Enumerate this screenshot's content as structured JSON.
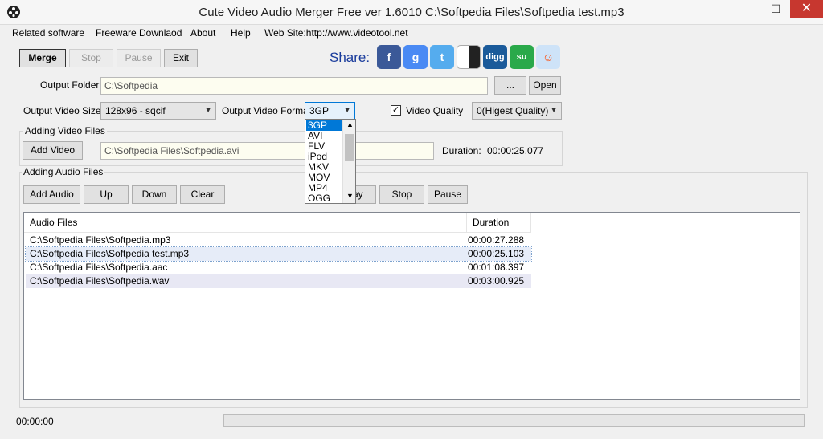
{
  "window": {
    "title": "Cute Video Audio Merger Free  ver 1.6010  C:\\Softpedia Files\\Softpedia test.mp3",
    "minimize": "—",
    "maximize": "☐",
    "close": "✕"
  },
  "menu": {
    "items": [
      "Related software",
      "Freeware Downlaod",
      "About",
      "Help",
      "Web Site:http://www.videotool.net"
    ]
  },
  "toolbar": {
    "merge": "Merge",
    "stop": "Stop",
    "pause": "Pause",
    "exit": "Exit",
    "share_label": "Share:"
  },
  "share_icons": [
    {
      "name": "facebook-icon",
      "glyph": "f",
      "color": "#3b5998"
    },
    {
      "name": "google-icon",
      "glyph": "g",
      "color": "#4a8af4"
    },
    {
      "name": "twitter-icon",
      "glyph": "t",
      "color": "#55acee"
    },
    {
      "name": "delicious-icon",
      "glyph": "",
      "color": "#3274d1"
    },
    {
      "name": "digg-icon",
      "glyph": "digg",
      "color": "#1a5a9a"
    },
    {
      "name": "stumbleupon-icon",
      "glyph": "su",
      "color": "#2aa94a"
    },
    {
      "name": "reddit-icon",
      "glyph": "☺",
      "color": "#cee3f8"
    }
  ],
  "output": {
    "folder_label": "Output Folder:",
    "folder_value": "C:\\Softpedia",
    "browse": "...",
    "open": "Open",
    "size_label": "Output Video Size:",
    "size_value": "128x96 - sqcif",
    "format_label": "Output Video Format:",
    "format_value": "3GP",
    "quality_label": "Video Quality",
    "quality_checked": true,
    "quality_value": "0(Higest Quality)"
  },
  "video_group": {
    "title": "Adding Video Files",
    "add_video": "Add Video",
    "video_path": "C:\\Softpedia Files\\Softpedia.avi",
    "duration_label": "Duration:",
    "duration_value": "00:00:25.077"
  },
  "audio_group": {
    "title": "Adding Audio Files",
    "add_audio": "Add Audio",
    "up": "Up",
    "down": "Down",
    "clear": "Clear",
    "play": "Play",
    "stop": "Stop",
    "pause": "Pause"
  },
  "audio_list": {
    "columns": [
      "Audio Files",
      "Duration"
    ],
    "rows": [
      {
        "file": "C:\\Softpedia Files\\Softpedia.mp3",
        "duration": "00:00:27.288"
      },
      {
        "file": "C:\\Softpedia Files\\Softpedia test.mp3",
        "duration": "00:00:25.103"
      },
      {
        "file": "C:\\Softpedia Files\\Softpedia.aac",
        "duration": "00:01:08.397"
      },
      {
        "file": "C:\\Softpedia Files\\Softpedia.wav",
        "duration": "00:03:00.925"
      }
    ]
  },
  "format_dropdown": {
    "options": [
      "3GP",
      "AVI",
      "FLV",
      "iPod",
      "MKV",
      "MOV",
      "MP4",
      "OGG"
    ],
    "selected_index": 0
  },
  "status": {
    "time": "00:00:00",
    "progress": 0
  }
}
